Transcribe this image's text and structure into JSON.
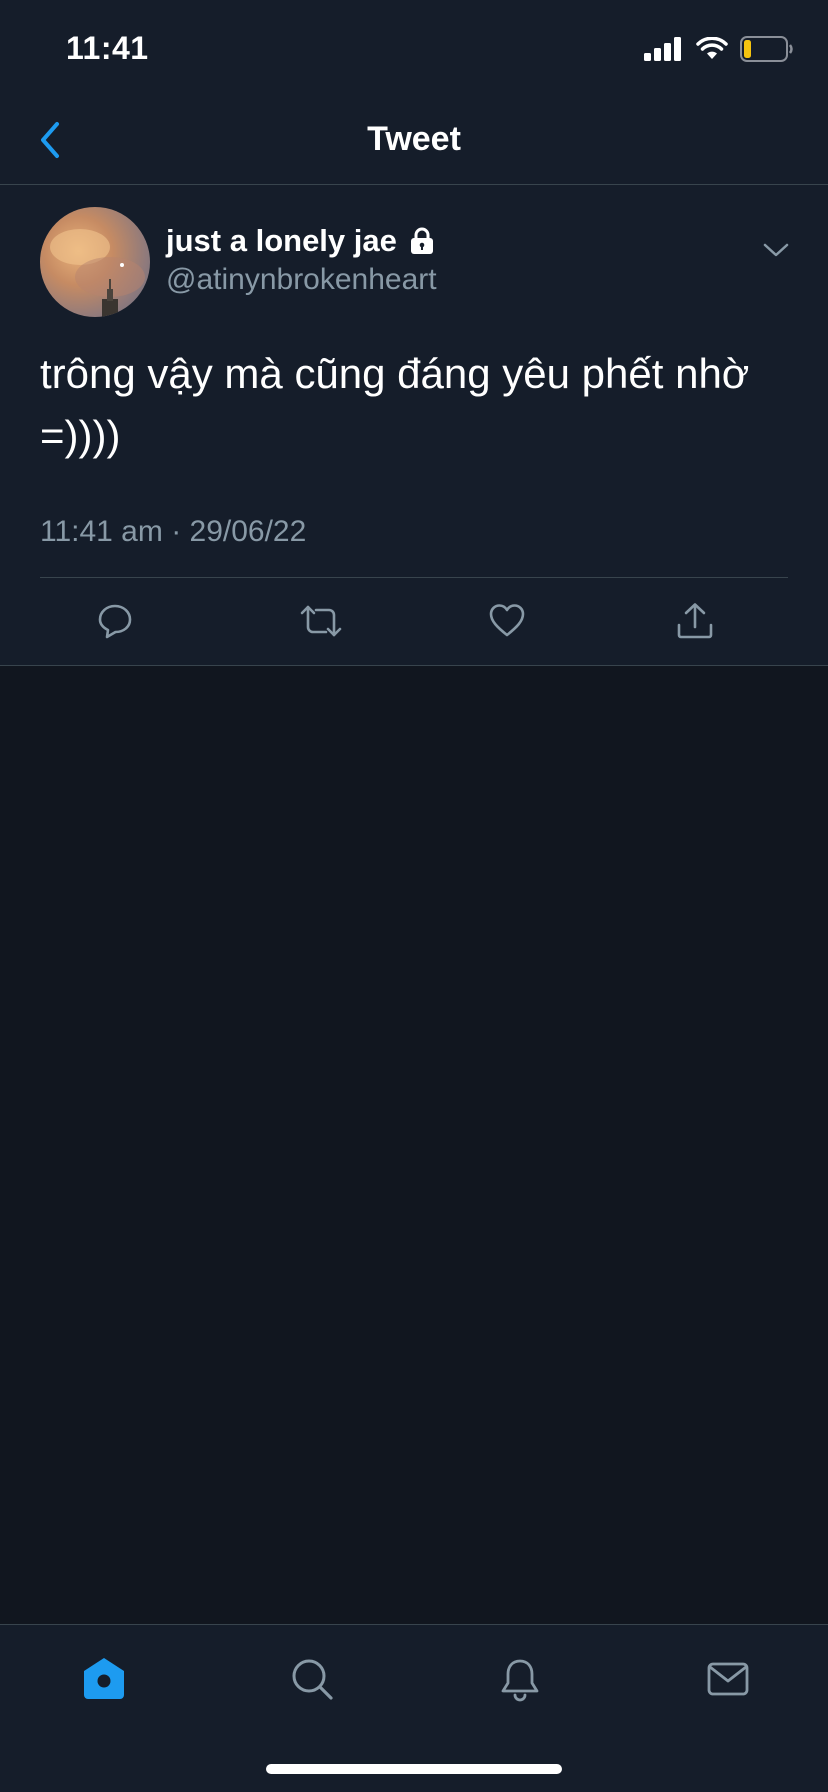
{
  "status_bar": {
    "time": "11:41",
    "battery_color": "#f5c40f"
  },
  "header": {
    "title": "Tweet",
    "back_icon": "chevron-left-icon",
    "accent_color": "#1d9bf0"
  },
  "tweet": {
    "author": {
      "name": "just a lonely jae",
      "handle": "@atinynbrokenheart",
      "protected_icon": "lock-icon",
      "avatar_icon": "avatar-photo"
    },
    "text": "trông vậy mà cũng đáng yêu phết nhờ =))))",
    "timestamp": "11:41 am · 29/06/22",
    "actions": [
      {
        "name": "reply",
        "icon": "comment-icon"
      },
      {
        "name": "retweet",
        "icon": "retweet-icon"
      },
      {
        "name": "like",
        "icon": "heart-icon"
      },
      {
        "name": "share",
        "icon": "share-icon"
      }
    ]
  },
  "tab_bar": {
    "tabs": [
      {
        "name": "home",
        "icon": "home-icon",
        "active": true
      },
      {
        "name": "search",
        "icon": "search-icon",
        "active": false
      },
      {
        "name": "notifications",
        "icon": "bell-icon",
        "active": false
      },
      {
        "name": "messages",
        "icon": "mail-icon",
        "active": false
      }
    ]
  }
}
